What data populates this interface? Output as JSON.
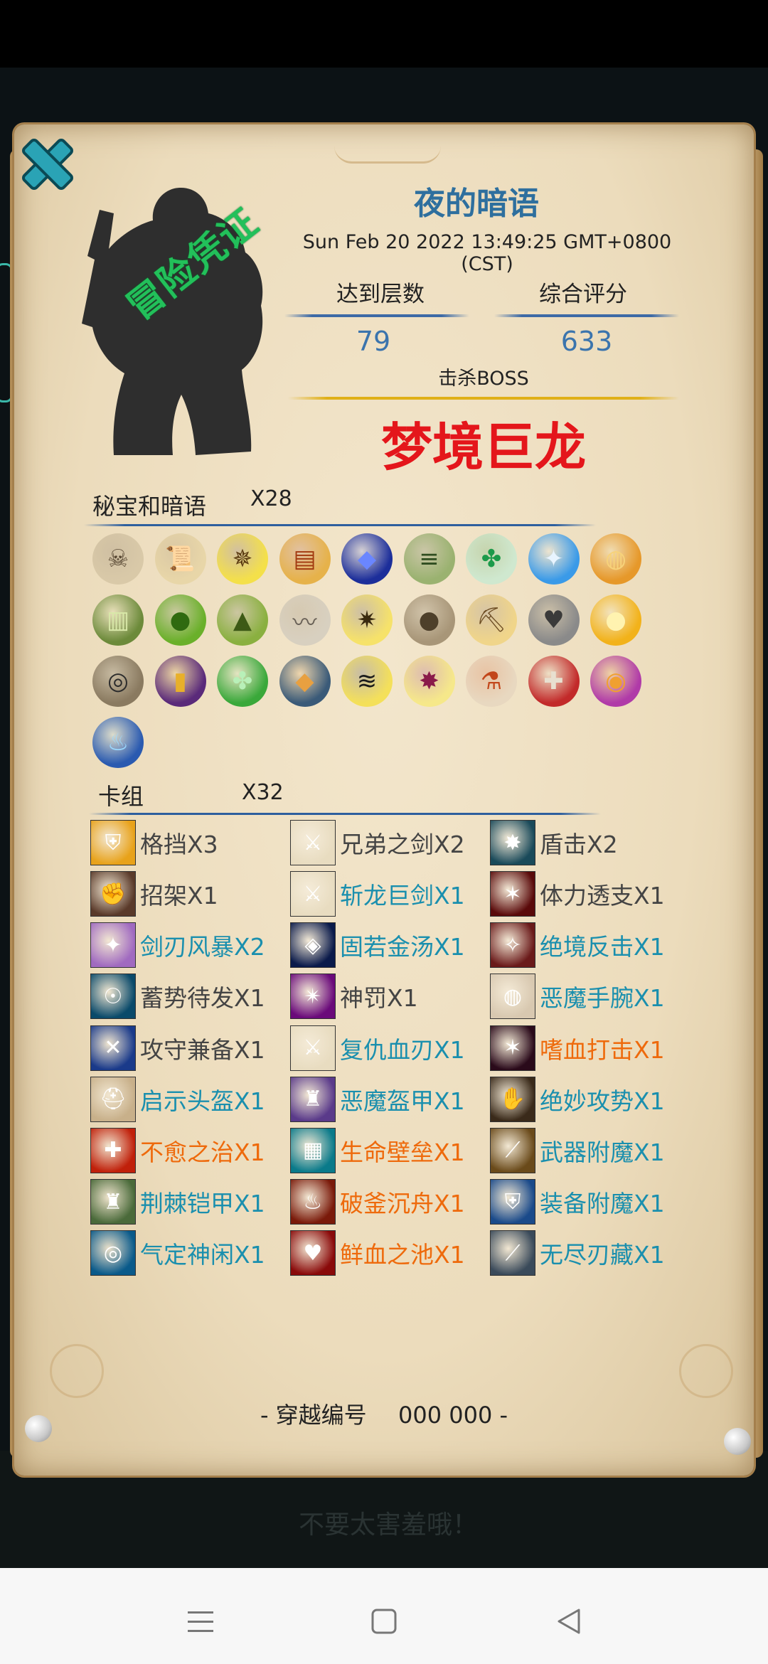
{
  "header": {
    "title": "夜的暗语",
    "datetime": "Sun Feb 20 2022 13:49:25 GMT+0800 (CST)",
    "stamp": "冒险凭证"
  },
  "stats": {
    "floor_label": "达到层数",
    "floor_value": "79",
    "score_label": "综合评分",
    "score_value": "633",
    "boss_label": "击杀BOSS",
    "boss_name": "梦境巨龙"
  },
  "treasures": {
    "title": "秘宝和暗语",
    "count": "X28",
    "items": [
      {
        "icon": "skull-icon",
        "glyph": "☠",
        "bg": "#d9c9a8",
        "fg": "#5a4a35"
      },
      {
        "icon": "scroll-icon",
        "glyph": "📜",
        "bg": "#e8d6a8",
        "fg": "#8a6a30"
      },
      {
        "icon": "yellow-rune-icon",
        "glyph": "✵",
        "bg": "#f4e04a",
        "fg": "#5a3a10"
      },
      {
        "icon": "treasure-map-icon",
        "glyph": "▤",
        "bg": "#e6b24a",
        "fg": "#a23a10"
      },
      {
        "icon": "blue-cloth-icon",
        "glyph": "◆",
        "bg": "#1c2e9a",
        "fg": "#6a86ff"
      },
      {
        "icon": "green-scroll-icon",
        "glyph": "≡",
        "bg": "#9ab270",
        "fg": "#2f4d20"
      },
      {
        "icon": "green-rune-icon",
        "glyph": "✤",
        "bg": "#cfe8cf",
        "fg": "#1c9a4a"
      },
      {
        "icon": "blue-rune-icon",
        "glyph": "✦",
        "bg": "#3a9ae8",
        "fg": "#e8f4ff"
      },
      {
        "icon": "bread-icon",
        "glyph": "◍",
        "bg": "#e6982a",
        "fg": "#f7d27a"
      },
      {
        "icon": "green-book-icon",
        "glyph": "▥",
        "bg": "#6c8a3a",
        "fg": "#d8e8a8"
      },
      {
        "icon": "green-beans-icon",
        "glyph": "●",
        "bg": "#6ab02a",
        "fg": "#2f6a10"
      },
      {
        "icon": "zongzi-icon",
        "glyph": "▲",
        "bg": "#8ab040",
        "fg": "#3d5a16"
      },
      {
        "icon": "bat-wings-icon",
        "glyph": "〰",
        "bg": "#d8d0c0",
        "fg": "#6a6258"
      },
      {
        "icon": "yellow-rune2-icon",
        "glyph": "✷",
        "bg": "#f6e26a",
        "fg": "#3a2a10"
      },
      {
        "icon": "sack-icon",
        "glyph": "●",
        "bg": "#a89678",
        "fg": "#4d3f2a"
      },
      {
        "icon": "pickaxe-card-icon",
        "glyph": "⛏",
        "bg": "#f0d58a",
        "fg": "#6a4a20"
      },
      {
        "icon": "stone-heart-icon",
        "glyph": "♥",
        "bg": "#8a8a8a",
        "fg": "#3a3a3a"
      },
      {
        "icon": "golden-orb-icon",
        "glyph": "●",
        "bg": "#f2b21a",
        "fg": "#fff3b0"
      },
      {
        "icon": "goggles-icon",
        "glyph": "◎",
        "bg": "#8a7a60",
        "fg": "#2d2d2d"
      },
      {
        "icon": "purple-barrel-icon",
        "glyph": "▮",
        "bg": "#5a2a7a",
        "fg": "#e8b02a"
      },
      {
        "icon": "clover-icon",
        "glyph": "✤",
        "bg": "#3aa83a",
        "fg": "#b8f0b8"
      },
      {
        "icon": "stone-tablet-icon",
        "glyph": "◆",
        "bg": "#3a5a78",
        "fg": "#e8a040"
      },
      {
        "icon": "yellow-swirl-icon",
        "glyph": "≋",
        "bg": "#f4e05a",
        "fg": "#1a1a1a"
      },
      {
        "icon": "yellow-rune3-icon",
        "glyph": "✸",
        "bg": "#f6e88a",
        "fg": "#8a1a4a"
      },
      {
        "icon": "potion-tube-icon",
        "glyph": "⚗",
        "bg": "#e8d8c0",
        "fg": "#c2461a"
      },
      {
        "icon": "stocking-icon",
        "glyph": "✚",
        "bg": "#c22a2a",
        "fg": "#e8e0d0"
      },
      {
        "icon": "purple-swirl-icon",
        "glyph": "◉",
        "bg": "#b03aa8",
        "fg": "#f0a030"
      },
      {
        "icon": "blue-flame-icon",
        "glyph": "♨",
        "bg": "#2a5ab0",
        "fg": "#9ad8ff"
      }
    ]
  },
  "deck": {
    "title": "卡组",
    "count": "X32",
    "cards": [
      {
        "label": "格挡X3",
        "color": "gray",
        "icon": "shield-icon",
        "glyph": "⛨",
        "bg": "#e8a21a"
      },
      {
        "label": "兄弟之剑X2",
        "color": "gray",
        "icon": "sword-icon",
        "glyph": "⚔",
        "bg": "#e8dcc0"
      },
      {
        "label": "盾击X2",
        "color": "gray",
        "icon": "shield-bash-icon",
        "glyph": "✸",
        "bg": "#1a4a5a"
      },
      {
        "label": "招架X1",
        "color": "gray",
        "icon": "parry-icon",
        "glyph": "✊",
        "bg": "#5a3a2a"
      },
      {
        "label": "斩龙巨剑X1",
        "color": "teal",
        "icon": "dragon-sword-icon",
        "glyph": "⚔",
        "bg": "#e8dcc0"
      },
      {
        "label": "体力透支X1",
        "color": "gray",
        "icon": "exhaustion-icon",
        "glyph": "✶",
        "bg": "#5a0a0a"
      },
      {
        "label": "剑刃风暴X2",
        "color": "teal",
        "icon": "bladestorm-icon",
        "glyph": "✦",
        "bg": "#a06ac0"
      },
      {
        "label": "固若金汤X1",
        "color": "teal",
        "icon": "fortress-icon",
        "glyph": "◈",
        "bg": "#0a1a4a"
      },
      {
        "label": "绝境反击X1",
        "color": "teal",
        "icon": "counterattack-icon",
        "glyph": "✧",
        "bg": "#6a1a1a"
      },
      {
        "label": "蓄势待发X1",
        "color": "gray",
        "icon": "charge-up-icon",
        "glyph": "☉",
        "bg": "#0a4a6a"
      },
      {
        "label": "神罚X1",
        "color": "gray",
        "icon": "divine-punish-icon",
        "glyph": "✴",
        "bg": "#6a0a7a"
      },
      {
        "label": "恶魔手腕X1",
        "color": "teal",
        "icon": "demon-wrist-icon",
        "glyph": "◍",
        "bg": "#d8c8b0"
      },
      {
        "label": "攻守兼备X1",
        "color": "gray",
        "icon": "balance-icon",
        "glyph": "✕",
        "bg": "#1a3a8a"
      },
      {
        "label": "复仇血刃X1",
        "color": "teal",
        "icon": "revenge-blade-icon",
        "glyph": "⚔",
        "bg": "#e8dcc0"
      },
      {
        "label": "嗜血打击X1",
        "color": "orange",
        "icon": "bloodthirst-icon",
        "glyph": "✶",
        "bg": "#2a0a1a"
      },
      {
        "label": "启示头盔X1",
        "color": "teal",
        "icon": "helmet-icon",
        "glyph": "⛑",
        "bg": "#c8b08a"
      },
      {
        "label": "恶魔盔甲X1",
        "color": "teal",
        "icon": "demon-armor-icon",
        "glyph": "♜",
        "bg": "#5a3a8a"
      },
      {
        "label": "绝妙攻势X1",
        "color": "teal",
        "icon": "palm-icon",
        "glyph": "✋",
        "bg": "#3a2a1a"
      },
      {
        "label": "不愈之治X1",
        "color": "orange",
        "icon": "wound-icon",
        "glyph": "✚",
        "bg": "#c0200a"
      },
      {
        "label": "生命壁垒X1",
        "color": "orange",
        "icon": "life-wall-icon",
        "glyph": "▦",
        "bg": "#0a7a8a"
      },
      {
        "label": "武器附魔X1",
        "color": "teal",
        "icon": "weapon-enchant-icon",
        "glyph": "⟋",
        "bg": "#6a4a1a"
      },
      {
        "label": "荆棘铠甲X1",
        "color": "teal",
        "icon": "thorn-armor-icon",
        "glyph": "♜",
        "bg": "#4a6a3a"
      },
      {
        "label": "破釜沉舟X1",
        "color": "orange",
        "icon": "burn-boats-icon",
        "glyph": "♨",
        "bg": "#7a1a0a"
      },
      {
        "label": "装备附魔X1",
        "color": "teal",
        "icon": "gear-enchant-icon",
        "glyph": "⛨",
        "bg": "#1a4a8a"
      },
      {
        "label": "气定神闲X1",
        "color": "teal",
        "icon": "calm-icon",
        "glyph": "◎",
        "bg": "#0a5a8a"
      },
      {
        "label": "鲜血之池X1",
        "color": "orange",
        "icon": "blood-pool-icon",
        "glyph": "♥",
        "bg": "#8a0a0a"
      },
      {
        "label": "无尽刃藏X1",
        "color": "teal",
        "icon": "endless-blades-icon",
        "glyph": "⟋",
        "bg": "#3a4a5a"
      }
    ]
  },
  "footer": {
    "serial_label": "- 穿越编号",
    "serial_value": "000 000 -"
  },
  "background": {
    "dim_text": "不要太害羞哦！"
  },
  "colors": {
    "title": "#2e6f9e",
    "boss": "#e4161b",
    "stamp": "#22c05a",
    "teal_card": "#1a8fae",
    "orange_card": "#ee6a0c"
  }
}
